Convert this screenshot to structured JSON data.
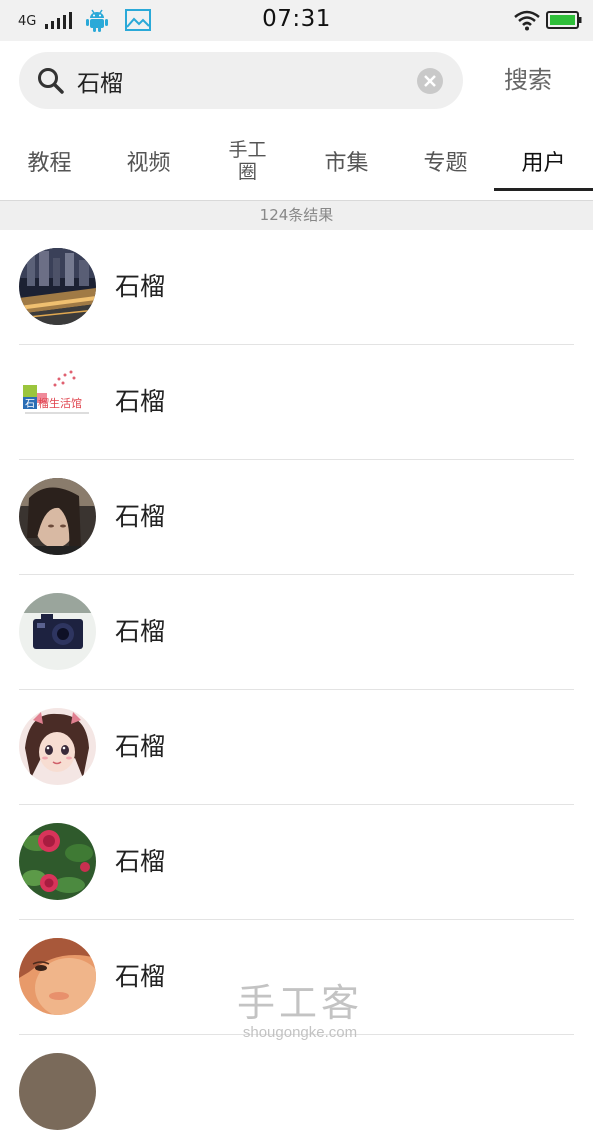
{
  "status_bar": {
    "network": "4G",
    "time": "07:31",
    "icons": [
      "signal-icon",
      "android-debug-icon",
      "gallery-icon",
      "wifi-icon",
      "battery-icon"
    ],
    "accent_color": "#2aa9d8",
    "battery_color": "#2fbf3a"
  },
  "search": {
    "query": "石榴",
    "button_label": "搜索"
  },
  "tabs": [
    {
      "label": "教程",
      "active": false
    },
    {
      "label": "视频",
      "active": false
    },
    {
      "label": "手工圈",
      "active": false
    },
    {
      "label": "市集",
      "active": false
    },
    {
      "label": "专题",
      "active": false
    },
    {
      "label": "用户",
      "active": true
    }
  ],
  "result_count": "124条结果",
  "users": [
    {
      "name": "石榴",
      "avatar": "city-night-avatar"
    },
    {
      "name": "石榴",
      "avatar": "logo-avatar"
    },
    {
      "name": "石榴",
      "avatar": "portrait-avatar"
    },
    {
      "name": "石榴",
      "avatar": "camera-avatar"
    },
    {
      "name": "石榴",
      "avatar": "cartoon-girl-avatar"
    },
    {
      "name": "石榴",
      "avatar": "rose-avatar"
    },
    {
      "name": "石榴",
      "avatar": "face-closeup-avatar"
    }
  ],
  "avatar_logo_text": "石榴生活馆",
  "watermark": {
    "logo": "手工客",
    "url": "shougongke.com"
  }
}
